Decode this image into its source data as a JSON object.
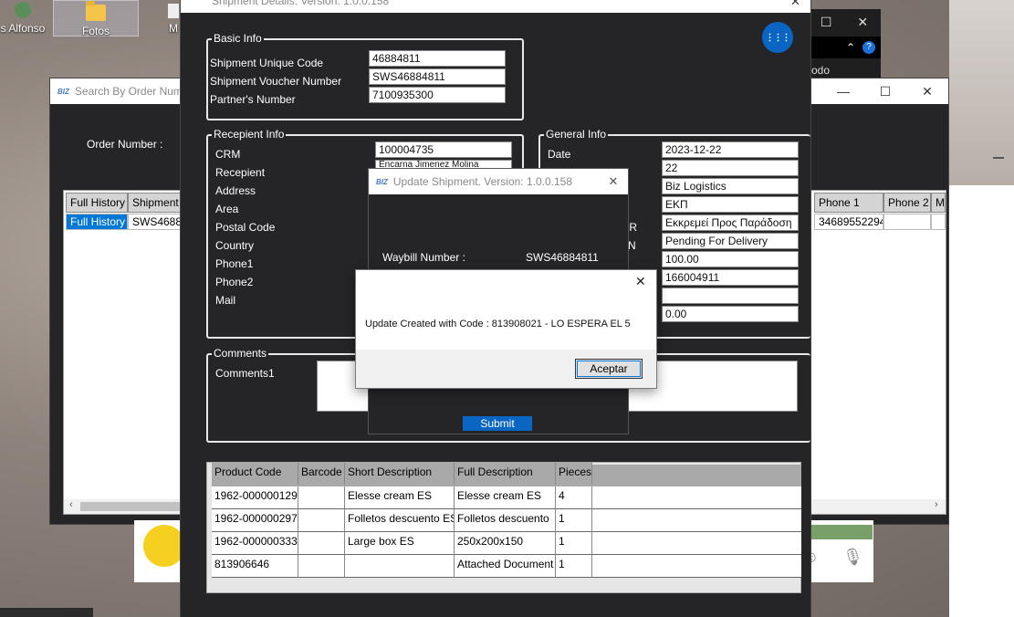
{
  "desktop": {
    "icons": [
      {
        "label": "s Alfonso"
      },
      {
        "label": "Fotos"
      },
      {
        "label": "M"
      }
    ]
  },
  "background_window": {
    "text": "odo"
  },
  "search_window": {
    "title": "Search By Order Numb",
    "order_number_label": "Order Number :",
    "columns_left": [
      "Full History",
      "Shipment N"
    ],
    "row_left": [
      "Full History",
      "SWS468848"
    ],
    "columns_right": [
      "Phone 1",
      "Phone 2",
      "M"
    ],
    "row_right": [
      "34689552294",
      "",
      ""
    ]
  },
  "shipment_window": {
    "title": "Shipment Details. Version: 1.0.0.158",
    "basic_info": {
      "title": "Basic Info",
      "fields": [
        {
          "label": "Shipment Unique Code",
          "value": "46884811"
        },
        {
          "label": "Shipment Voucher Number",
          "value": "SWS46884811"
        },
        {
          "label": "Partner's Number",
          "value": "7100935300"
        }
      ]
    },
    "recipient_info": {
      "title": "Recepient Info",
      "labels": [
        "CRM",
        "Recepient",
        "Address",
        "Area",
        "Postal Code",
        "Country",
        "Phone1",
        "Phone2",
        "Mail"
      ],
      "crm_value": "100004735",
      "recipient_value": "Encarna Jimenez Molina"
    },
    "general_info": {
      "title": "General Info",
      "labels": [
        "Date",
        "",
        "",
        "",
        "n GR",
        "n EN",
        "",
        "",
        "",
        ""
      ],
      "values": [
        "2023-12-22",
        "22",
        "Biz Logistics",
        "ΕΚΠ",
        "Εκκρεμεί Προς Παράδοση",
        "Pending For Delivery",
        "100.00",
        "166004911",
        "",
        "0.00"
      ]
    },
    "comments": {
      "title": "Comments",
      "label": "Comments1"
    },
    "products": {
      "columns": [
        "Product Code",
        "Barcode",
        "Short Description",
        "Full Description",
        "Pieces"
      ],
      "rows": [
        [
          "1962-000000129",
          "",
          "Elesse cream ES",
          "Elesse cream ES",
          "4"
        ],
        [
          "1962-000000297",
          "",
          "Folletos descuento ES",
          "Folletos descuento",
          "1"
        ],
        [
          "1962-000000333",
          "",
          "Large box ES",
          "250x200x150",
          "1"
        ],
        [
          "813906646",
          "",
          "",
          "Attached Document",
          "1"
        ]
      ]
    }
  },
  "update_window": {
    "title": "Update Shipment. Version: 1.0.0.158",
    "waybill_label": "Waybill Number :",
    "waybill_value": "SWS46884811",
    "submit_label": "Submit"
  },
  "message_box": {
    "message": "Update Created with Code : 813908021 - LO ESPERA EL 5",
    "accept_label": "Aceptar",
    "close_glyph": "✕"
  },
  "glyphs": {
    "close": "✕",
    "maximize": "☐",
    "minimize": "—",
    "dots": "⋮⋮⋮"
  },
  "colors": {
    "accent": "#0a66c2",
    "dark_bg": "#252528",
    "selected_row": "#0078d7"
  }
}
